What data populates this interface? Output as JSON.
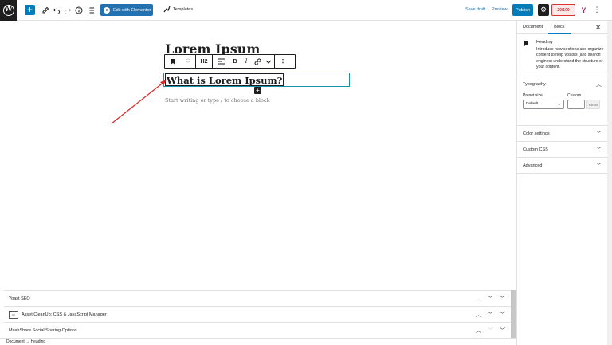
{
  "toolbar": {
    "elementor_label": "Edit with Elementor",
    "templates_label": "Templates",
    "save_draft": "Save draft",
    "preview": "Preview",
    "publish": "Publish",
    "seo_score": "20/100",
    "yoast_label": "Y"
  },
  "editor": {
    "post_title": "Lorem Ipsum",
    "heading_level": "H2",
    "heading_text": "What is Lorem Ipsum?",
    "appender_placeholder": "Start writing or type / to choose a block"
  },
  "colors": {
    "accent": "#007cba",
    "annotation_arrow": "#dc2626",
    "seo_bad": "#dc3232"
  },
  "metaboxes": [
    {
      "title": "Yoast SEO"
    },
    {
      "title": "Asset CleanUp: CSS & JavaScript Manager"
    },
    {
      "title": "MashShare Social Sharing Options"
    }
  ],
  "statusbar": {
    "breadcrumb": "Document  →  Heading"
  },
  "sidebar": {
    "tabs": [
      "Document",
      "Block"
    ],
    "active_tab": "Block",
    "block_name": "Heading",
    "block_description": "Introduce new sections and organize content to help visitors (and search engines) understand the structure of your content.",
    "typography_title": "Typography",
    "preset_size_label": "Preset size",
    "custom_label": "Custom",
    "preset_value": "Default",
    "reset_label": "Reset",
    "panels": [
      "Color settings",
      "Custom CSS",
      "Advanced"
    ]
  }
}
